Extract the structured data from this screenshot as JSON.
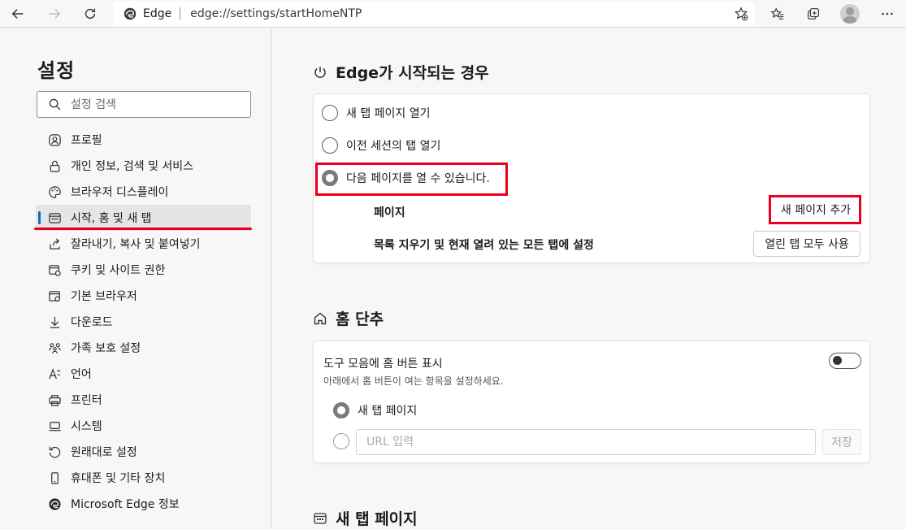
{
  "browser": {
    "site_label": "Edge",
    "url": "edge://settings/startHomeNTP"
  },
  "sidebar": {
    "title": "설정",
    "search_placeholder": "설정 검색",
    "items": [
      {
        "label": "프로필",
        "icon": "profile-icon"
      },
      {
        "label": "개인 정보, 검색 및 서비스",
        "icon": "lock-icon"
      },
      {
        "label": "브라우저 디스플레이",
        "icon": "palette-icon"
      },
      {
        "label": "시작, 홈 및 새 탭",
        "icon": "start-home-icon",
        "active": true
      },
      {
        "label": "잘라내기, 복사 및 붙여넣기",
        "icon": "share-icon"
      },
      {
        "label": "쿠키 및 사이트 권한",
        "icon": "site-permissions-icon"
      },
      {
        "label": "기본 브라우저",
        "icon": "default-browser-icon"
      },
      {
        "label": "다운로드",
        "icon": "download-icon"
      },
      {
        "label": "가족 보호 설정",
        "icon": "family-icon"
      },
      {
        "label": "언어",
        "icon": "language-icon"
      },
      {
        "label": "프린터",
        "icon": "printer-icon"
      },
      {
        "label": "시스템",
        "icon": "system-icon"
      },
      {
        "label": "원래대로 설정",
        "icon": "reset-icon"
      },
      {
        "label": "휴대폰 및 기타 장치",
        "icon": "phone-icon"
      },
      {
        "label": "Microsoft Edge 정보",
        "icon": "edge-icon"
      }
    ]
  },
  "startup": {
    "title": "Edge가 시작되는 경우",
    "options": [
      {
        "label": "새 탭 페이지 열기",
        "checked": false
      },
      {
        "label": "이전 세션의 탭 열기",
        "checked": false
      },
      {
        "label": "다음 페이지를 열 수 있습니다.",
        "checked": true
      }
    ],
    "pages_label": "페이지",
    "add_page_button": "새 페이지 추가",
    "clear_label": "목록 지우기 및 현재 열려 있는 모든 탭에 설정",
    "use_open_tabs_button": "열린 탭 모두 사용"
  },
  "home": {
    "title": "홈 단추",
    "toggle_label": "도구 모음에 홈 버튼 표시",
    "toggle_on": false,
    "subtitle": "아래에서 홈 버튼이 여는 항목을 설정하세요.",
    "options": [
      {
        "label": "새 탭 페이지",
        "checked": true
      }
    ],
    "url_placeholder": "URL 입력",
    "save_button": "저장"
  },
  "newtab": {
    "title": "새 탭 페이지"
  },
  "colors": {
    "highlight": "#e8001c",
    "accent": "#0f6cbd"
  }
}
